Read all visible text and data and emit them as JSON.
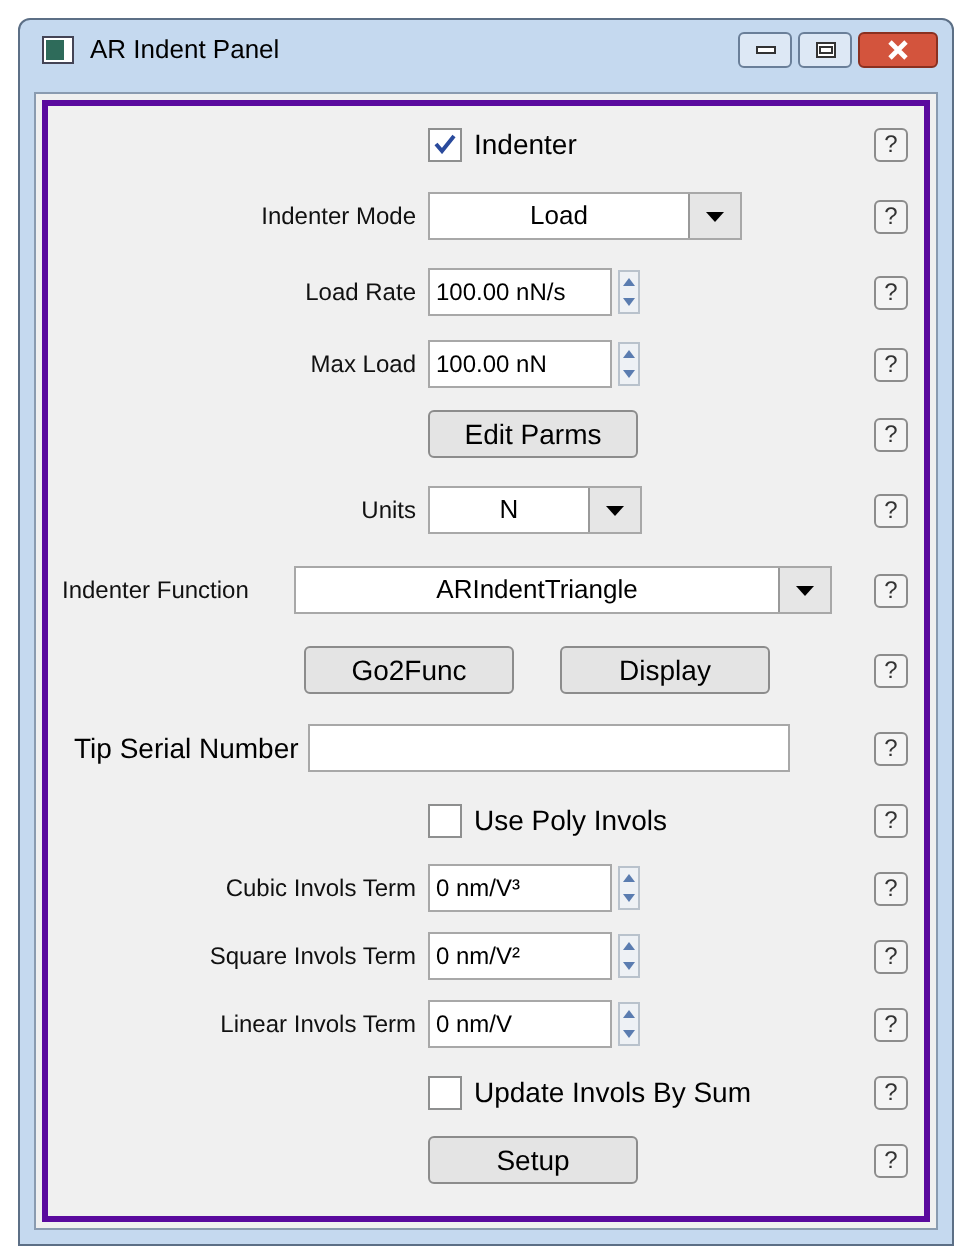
{
  "window": {
    "title": "AR Indent Panel"
  },
  "rows": [
    {
      "kind": "checkbox",
      "label": "Indenter",
      "checked": true,
      "help": "?"
    },
    {
      "kind": "select",
      "label": "Indenter Mode",
      "value": "Load",
      "help": "?"
    },
    {
      "kind": "spin",
      "label": "Load Rate",
      "value": "100.00 nN/s",
      "help": "?"
    },
    {
      "kind": "spin",
      "label": "Max Load",
      "value": "100.00 nN",
      "help": "?"
    },
    {
      "kind": "button",
      "label": "Edit Parms",
      "help": "?"
    },
    {
      "kind": "small_select",
      "label": "Units",
      "value": "N",
      "help": "?"
    },
    {
      "kind": "wide_select",
      "label": "Indenter Function",
      "value": "ARIndentTriangle",
      "help": "?"
    },
    {
      "kind": "buttons",
      "buttons": [
        "Go2Func",
        "Display"
      ],
      "help": "?"
    },
    {
      "kind": "text",
      "label": "Tip Serial Number",
      "help": "?"
    },
    {
      "kind": "checkbox",
      "label": "Use Poly Invols",
      "checked": false,
      "help": "?"
    },
    {
      "kind": "spin",
      "label": "Cubic Invols Term",
      "value": "0 nm/V³",
      "help": "?"
    },
    {
      "kind": "spin",
      "label": "Square Invols Term",
      "value": "0 nm/V²",
      "help": "?"
    },
    {
      "kind": "spin",
      "label": "Linear Invols Term",
      "value": "0 nm/V",
      "help": "?"
    },
    {
      "kind": "checkbox",
      "label": "Update Invols By Sum",
      "checked": false,
      "help": "?"
    },
    {
      "kind": "button",
      "label": "Setup",
      "help": "?"
    }
  ]
}
